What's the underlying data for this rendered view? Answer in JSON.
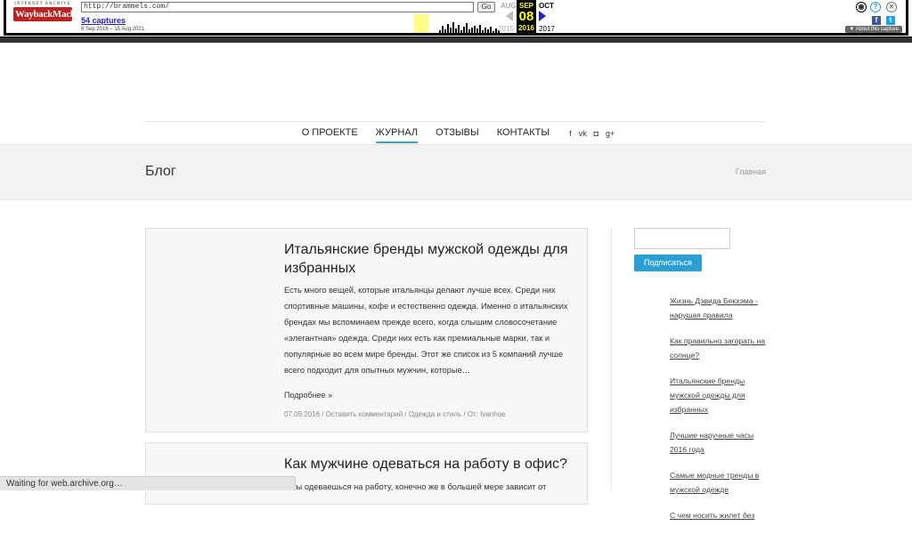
{
  "wayback": {
    "logo_top": "INTERNET ARCHIVE",
    "logo_main": "WaybackMachine",
    "url": "http://brammels.com/",
    "go_label": "Go",
    "captures": "54 captures",
    "date_range": "8 Sep 2016 – 15 Aug 2021",
    "prev_month": "AUG",
    "cur_month": "SEP",
    "next_month": "OCT",
    "cur_day": "08",
    "prev_year": "2015",
    "cur_year": "2016",
    "next_year": "2017",
    "about": "▼ About this capture",
    "help_symbol": "?",
    "close_symbol": "✕",
    "fb_symbol": "f",
    "tw_symbol": "t",
    "user_symbol": "◉"
  },
  "nav": {
    "items": [
      {
        "label": "О ПРОЕКТЕ"
      },
      {
        "label": "ЖУРНАЛ",
        "active": true
      },
      {
        "label": "ОТЗЫВЫ"
      },
      {
        "label": "КОНТАКТЫ"
      }
    ],
    "social": [
      "f",
      "vk",
      "◘",
      "g+"
    ]
  },
  "header": {
    "title": "Блог",
    "breadcrumb": "Главная"
  },
  "posts": [
    {
      "title": "Итальянские бренды мужской одежды для избранных",
      "excerpt": "Есть много вещей, которые итальянцы делают лучше всех. Среди них спортивные машины, кофе и естественно одежда. Именно о итальянских брендах мы вспоминаем прежде всего, когда слышим словосочетание «элегантная» одежда. Среди них есть как премиальные марки, так и популярные во всем мире бренды. Этот же список из 5 компаний лучше всего подходит для опытных мужчин, которые…",
      "more": "Подробнее »",
      "meta": "07.09.2016  /  Оставить комментарий  /  Одежда и стиль  /  От: Ivanhoe"
    },
    {
      "title": "Как мужчине одеваться на работу в офис?",
      "excerpt": "…ты одеваешься на работу,  конечно же в большей мере зависит от"
    }
  ],
  "sidebar": {
    "subscribe_label": "Подписаться",
    "recent": [
      "Жизнь Дэвида Бекхэма - нарушая правила",
      "Как правильно загорать на солнце?",
      "Итальянские бренды мужской одежды для избранных",
      "Лучшие наручные часы 2016 года",
      "Самые модные тренды в мужской одежде",
      "С чем носить жилет без"
    ]
  },
  "status_bar": "Waiting for web.archive.org…",
  "colors": {
    "accent": "#2b9fd4",
    "nav_underline": "#3aa6c8",
    "band": "#f2f2f2"
  }
}
